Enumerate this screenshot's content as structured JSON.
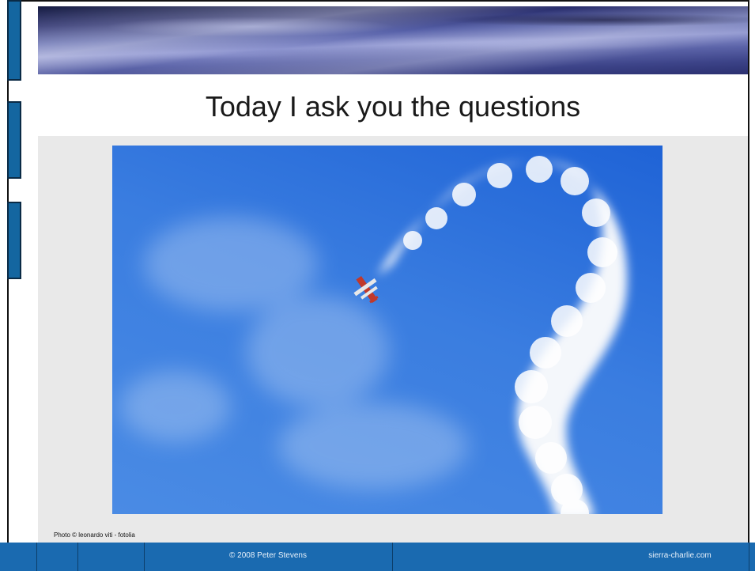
{
  "slide": {
    "title": "Today I ask you the questions",
    "photo_credit": "Photo © leonardo viti - fotolia",
    "photo": {
      "subject": "aerobatic plane smoke trail question mark"
    }
  },
  "footer": {
    "copyright": "© 2008 Peter Stevens",
    "site": "sierra-charlie.com"
  },
  "colors": {
    "tab_blue": "#1466a0",
    "footer_blue": "#1a6ab0",
    "sky_blue": "#2f74dd"
  }
}
